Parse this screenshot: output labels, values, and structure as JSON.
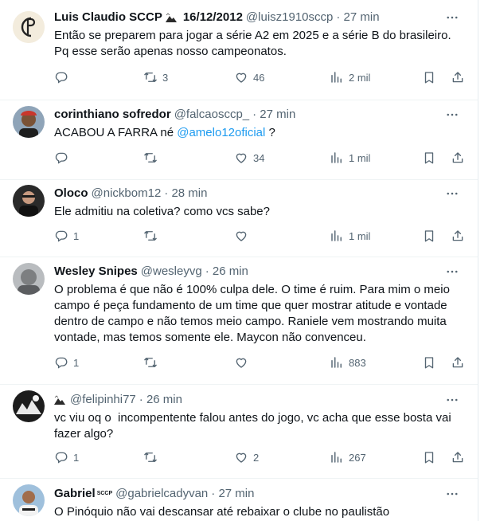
{
  "tweets": [
    {
      "name": "Luis Claudio SCCP",
      "name_suffix": "16/12/2012",
      "handle": "@luisz1910sccp",
      "time": "· 27 min",
      "text": "Então se preparem para jogar a série A2 em 2025 e a série B do brasileiro.\nPq esse serão apenas nosso campeonatos.",
      "replies": "",
      "retweets": "3",
      "likes": "46",
      "views": "2 mil"
    },
    {
      "name": "corinthiano sofredor",
      "handle": "@falcaosccp_",
      "time": "· 27 min",
      "text_before": "ACABOU A FARRA né ",
      "mention": "@amelo12oficial",
      "text_after": " ?",
      "replies": "",
      "retweets": "",
      "likes": "34",
      "views": "1 mil"
    },
    {
      "name": "Oloco",
      "handle": "@nickbom12",
      "time": "· 28 min",
      "text": "Ele admitiu na coletiva? como vcs sabe?",
      "replies": "1",
      "retweets": "",
      "likes": "",
      "views": "1 mil"
    },
    {
      "name": "Wesley Snipes",
      "handle": "@wesleyvg",
      "time": "· 26 min",
      "text": "O problema é que não é 100% culpa dele. O time é ruim. Para mim o meio\ncampo é peça fundamento de um time que quer mostrar atitude e vontade\ndentro de campo e não temos meio campo. Raniele vem mostrando muita\nvontade, mas temos somente ele. Maycon não convenceu.",
      "replies": "1",
      "retweets": "",
      "likes": "",
      "views": "883"
    },
    {
      "handle": "@felipinhi77",
      "time": "· 26 min",
      "text": "vc viu oq o  incompentente falou antes do jogo, vc acha que esse bosta vai\nfazer algo?",
      "replies": "1",
      "retweets": "",
      "likes": "2",
      "views": "267"
    },
    {
      "name": "Gabriel",
      "badge": "SCCP",
      "handle": "@gabrielcadyvan",
      "time": "· 27 min",
      "text": "O Pinóquio não vai descansar até rebaixar o clube no paulistão"
    }
  ],
  "icons": {
    "reply": "reply-icon",
    "retweet": "retweet-icon",
    "like": "heart-icon",
    "views": "views-icon",
    "bookmark": "bookmark-icon",
    "share": "share-icon",
    "more": "more-icon"
  },
  "colors": {
    "text": "#0f1419",
    "secondary": "#536471",
    "mention": "#1d9bf0",
    "divider": "#eff3f4"
  }
}
